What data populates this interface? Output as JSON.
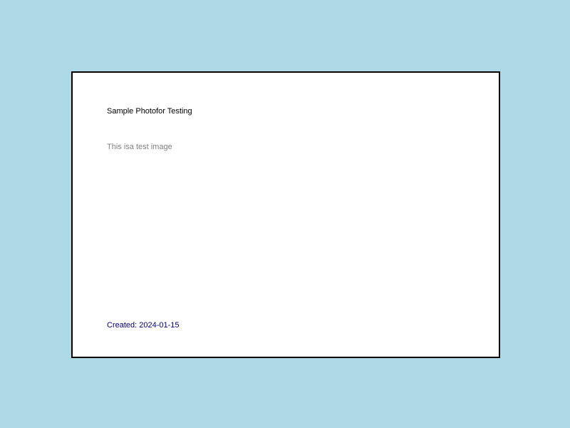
{
  "background_color": "#add8e6",
  "card": {
    "background_color": "#ffffff",
    "border_color": "#000000",
    "title": "Sample Photofor Testing",
    "description": "This isa test image",
    "created": "Created: 2024-01-15",
    "title_color": "#000000",
    "description_color": "#808080",
    "created_color": "#000080"
  }
}
